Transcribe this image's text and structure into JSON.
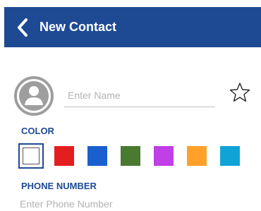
{
  "header": {
    "title": "New Contact",
    "background": "#1e4a94"
  },
  "icons": {
    "back": "chevron-left-icon",
    "avatar": "person-avatar-icon",
    "favorite": "star-outline-icon"
  },
  "name_input": {
    "placeholder": "Enter Name",
    "value": ""
  },
  "color_section": {
    "label": "COLOR",
    "swatches": [
      {
        "name": "white",
        "hex": "#ffffff",
        "selected": true
      },
      {
        "name": "red",
        "hex": "#e41e1e",
        "selected": false
      },
      {
        "name": "blue",
        "hex": "#1a5fcf",
        "selected": false
      },
      {
        "name": "green",
        "hex": "#4a7a2f",
        "selected": false
      },
      {
        "name": "purple",
        "hex": "#c03fe6",
        "selected": false
      },
      {
        "name": "orange",
        "hex": "#ffa128",
        "selected": false
      },
      {
        "name": "cyan",
        "hex": "#10a4d6",
        "selected": false
      }
    ]
  },
  "phone_section": {
    "label": "PHONE NUMBER",
    "placeholder": "Enter Phone Number",
    "value": ""
  }
}
